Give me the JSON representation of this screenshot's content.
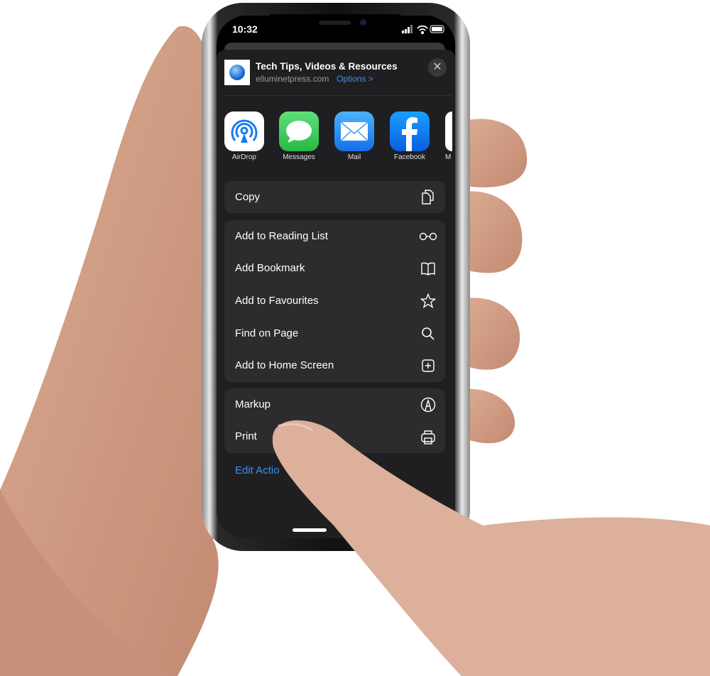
{
  "status_bar": {
    "time": "10:32",
    "signal_icon": "cellular-signal-icon",
    "wifi_icon": "wifi-icon",
    "battery_icon": "battery-icon"
  },
  "share_header": {
    "title": "Tech Tips, Videos & Resources",
    "domain": "elluminetpress.com",
    "options_label": "Options >",
    "close_symbol": "✕"
  },
  "apps": [
    {
      "label": "AirDrop",
      "color": "#ffffff"
    },
    {
      "label": "Messages",
      "color": "#34c759"
    },
    {
      "label": "Mail",
      "color": "#1a8cf0"
    },
    {
      "label": "Facebook",
      "color": "#1877f2"
    },
    {
      "label": "M",
      "color": "#ffffff"
    }
  ],
  "actions": {
    "copy": "Copy",
    "group2": [
      "Add to Reading List",
      "Add Bookmark",
      "Add to Favourites",
      "Find on Page",
      "Add to Home Screen"
    ],
    "group3": [
      "Markup",
      "Print"
    ]
  },
  "edit_actions": "Edit Actio",
  "colors": {
    "accent": "#3d8ff0",
    "sheet": "#1f1f21",
    "row": "#2c2c2e"
  }
}
